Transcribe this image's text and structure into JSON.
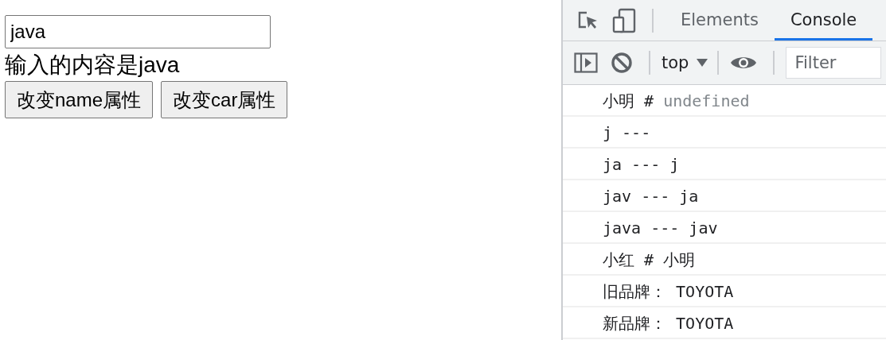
{
  "page": {
    "input": {
      "value": "java"
    },
    "output_text": "输入的内容是java",
    "buttons": [
      "改变name属性",
      "改变car属性"
    ]
  },
  "devtools": {
    "tabs": [
      {
        "label": "Elements",
        "selected": false
      },
      {
        "label": "Console",
        "selected": true
      }
    ],
    "console_toolbar": {
      "context": "top",
      "filter": {
        "placeholder": "Filter"
      }
    },
    "console_rows": [
      {
        "parts": [
          {
            "text": "小明",
            "kind": "plain"
          },
          {
            "text": "#",
            "kind": "plain"
          },
          {
            "text": "undefined",
            "kind": "undefined"
          }
        ]
      },
      {
        "parts": [
          {
            "text": "j ---",
            "kind": "plain"
          }
        ]
      },
      {
        "parts": [
          {
            "text": "ja --- j",
            "kind": "plain"
          }
        ]
      },
      {
        "parts": [
          {
            "text": "jav --- ja",
            "kind": "plain"
          }
        ]
      },
      {
        "parts": [
          {
            "text": "java --- jav",
            "kind": "plain"
          }
        ]
      },
      {
        "parts": [
          {
            "text": "小红",
            "kind": "plain"
          },
          {
            "text": "#",
            "kind": "plain"
          },
          {
            "text": "小明",
            "kind": "plain"
          }
        ]
      },
      {
        "parts": [
          {
            "text": "旧品牌：",
            "kind": "plain"
          },
          {
            "text": "TOYOTA",
            "kind": "plain"
          }
        ]
      },
      {
        "parts": [
          {
            "text": "新品牌：",
            "kind": "plain"
          },
          {
            "text": "TOYOTA",
            "kind": "plain"
          }
        ]
      }
    ]
  }
}
